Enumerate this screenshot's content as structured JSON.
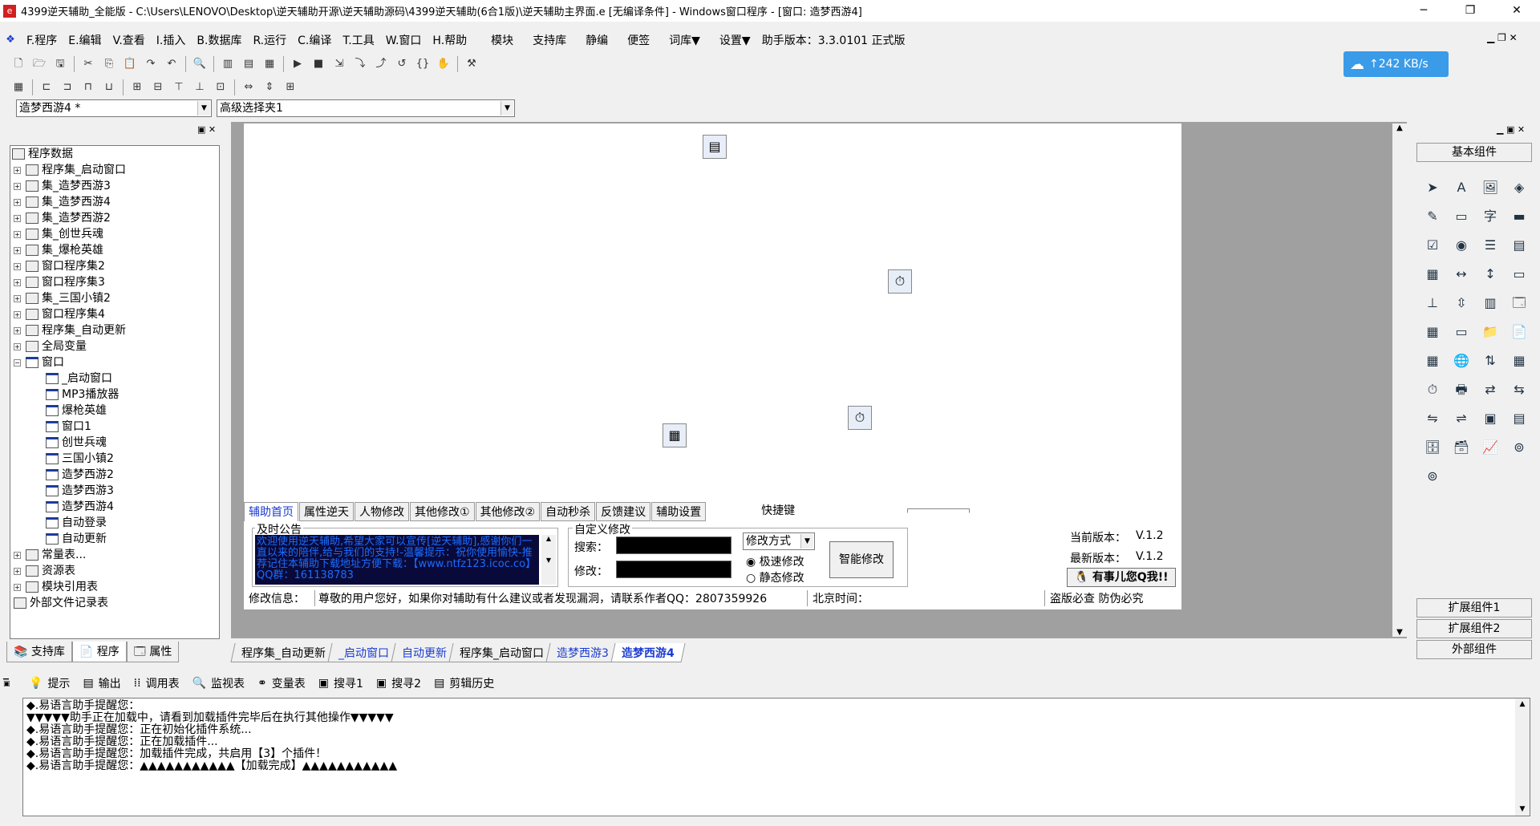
{
  "title": "4399逆天辅助_全能版 - C:\\Users\\LENOVO\\Desktop\\逆天辅助开源\\逆天辅助源码\\4399逆天辅助(6合1版)\\逆天辅助主界面.e [无编译条件] - Windows窗口程序 - [窗口: 造梦西游4]",
  "window_controls": {
    "minimize": "─",
    "restore": "❐",
    "close": "✕"
  },
  "menu": [
    "F.程序",
    "E.编辑",
    "V.查看",
    "I.插入",
    "B.数据库",
    "R.运行",
    "C.编译",
    "T.工具",
    "W.窗口",
    "H.帮助",
    "模块",
    "支持库",
    "静编",
    "便签",
    "词库▼",
    "设置▼",
    "助手版本：3.3.0101 正式版"
  ],
  "net_speed": "242 KB/s",
  "combos": {
    "window_select": "造梦西游4 *",
    "advanced_select": "高级选择夹1"
  },
  "tree": {
    "root": "程序数据",
    "items": [
      "程序集_启动窗口",
      "集_造梦西游3",
      "集_造梦西游4",
      "集_造梦西游2",
      "集_创世兵魂",
      "集_爆枪英雄",
      "窗口程序集2",
      "窗口程序集3",
      "集_三国小镇2",
      "窗口程序集4",
      "程序集_自动更新",
      "全局变量",
      "窗口"
    ],
    "windows": [
      "_启动窗口",
      "MP3播放器",
      "爆枪英雄",
      "窗口1",
      "创世兵魂",
      "三国小镇2",
      "造梦西游2",
      "造梦西游3",
      "造梦西游4",
      "自动登录",
      "自动更新"
    ],
    "tail": [
      "常量表...",
      "资源表",
      "模块引用表",
      "外部文件记录表"
    ]
  },
  "left_tabs": [
    "支持库",
    "程序",
    "属性"
  ],
  "form_tabs": [
    "辅助首页",
    "属性逆天",
    "人物修改",
    "其他修改①",
    "其他修改②",
    "自动秒杀",
    "反馈建议",
    "辅助设置"
  ],
  "shortcut_label": "快捷键",
  "announce": {
    "title": "及时公告",
    "text": "欢迎使用逆天辅助,希望大家可以宣传[逆天辅助],感谢你们一直以来的陪伴,给与我们的支持!-温馨提示：祝你使用愉快-推荐记住本辅助下载地址方便下载：【www.ntfz123.icoc.co】QQ群：161138783"
  },
  "custom": {
    "title": "自定义修改",
    "search": "搜索：",
    "modify": "修改：",
    "method": "修改方式",
    "fast": "极速修改",
    "static": "静态修改",
    "button": "智能修改"
  },
  "version": {
    "current_label": "当前版本：",
    "current": "V.1.2",
    "latest_label": "最新版本：",
    "latest": "V.1.2",
    "contact": "有事儿您Q我!!"
  },
  "status": {
    "label": "修改信息：",
    "text": "尊敬的用户您好，如果你对辅助有什么建议或者发现漏洞，请联系作者QQ：2807359926",
    "time_label": "北京时间：",
    "slogan": "盗版必查 防伪必究"
  },
  "right_panel": {
    "basic": "基本组件",
    "ext1": "扩展组件1",
    "ext2": "扩展组件2",
    "ext3": "外部组件"
  },
  "doc_tabs": [
    "程序集_自动更新",
    "_启动窗口",
    "自动更新",
    "程序集_启动窗口",
    "造梦西游3",
    "造梦西游4"
  ],
  "output_tabs": [
    "提示",
    "输出",
    "调用表",
    "监视表",
    "变量表",
    "搜寻1",
    "搜寻2",
    "剪辑历史"
  ],
  "output_lines": [
    "◆.易语言助手提醒您：",
    "▼▼▼▼▼助手正在加载中，请看到加载插件完毕后在执行其他操作▼▼▼▼▼",
    "◆.易语言助手提醒您：正在初始化插件系统...",
    "◆.易语言助手提醒您：正在加载插件...",
    "◆.易语言助手提醒您：加载插件完成，共启用【3】个插件！",
    "◆.易语言助手提醒您：▲▲▲▲▲▲▲▲▲▲▲【加载完成】▲▲▲▲▲▲▲▲▲▲▲"
  ]
}
